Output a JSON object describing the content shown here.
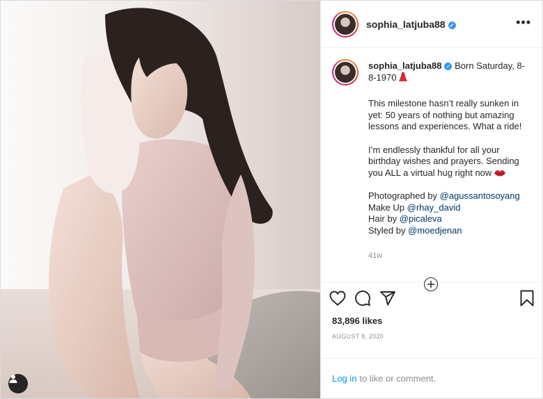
{
  "post": {
    "username": "sophia_latjuba88",
    "verified": true,
    "more_glyph": "•••",
    "caption": {
      "username": "sophia_latjuba88",
      "intro": "Born Saturday, 8-8-1970",
      "intro_emoji": "dress-emoji",
      "paragraph_1": "This milestone hasn’t really sunken in yet: 50 years of nothing but amazing lessons and experiences. What a ride!",
      "paragraph_2": "I’m endlessly thankful for all your birthday wishes and prayers. Sending you ALL a virtual hug right now",
      "paragraph_2_emoji": "lips-emoji",
      "credits": [
        {
          "prefix": "Photographed by ",
          "mention": "@agussantosoyang"
        },
        {
          "prefix": "Make Up ",
          "mention": "@rhay_david"
        },
        {
          "prefix": "Hair by ",
          "mention": "@picaleva"
        },
        {
          "prefix": "Styled by ",
          "mention": "@moedjenan"
        }
      ],
      "time_ago": "41w"
    },
    "likes": "83,896 likes",
    "date": "AUGUST 8, 2020",
    "login": {
      "link": "Log in",
      "rest": "to like or comment."
    }
  },
  "icons": {
    "more": "more-options-icon",
    "load_more": "plus-circle-icon",
    "like": "heart-icon",
    "comment": "comment-icon",
    "share": "send-icon",
    "save": "bookmark-icon",
    "tags": "user-tag-icon",
    "verified": "verified-badge-icon"
  },
  "colors": {
    "link": "#00376b",
    "login_link": "#0095f6",
    "verified": "#3897f0",
    "muted": "#8e8e8e"
  }
}
